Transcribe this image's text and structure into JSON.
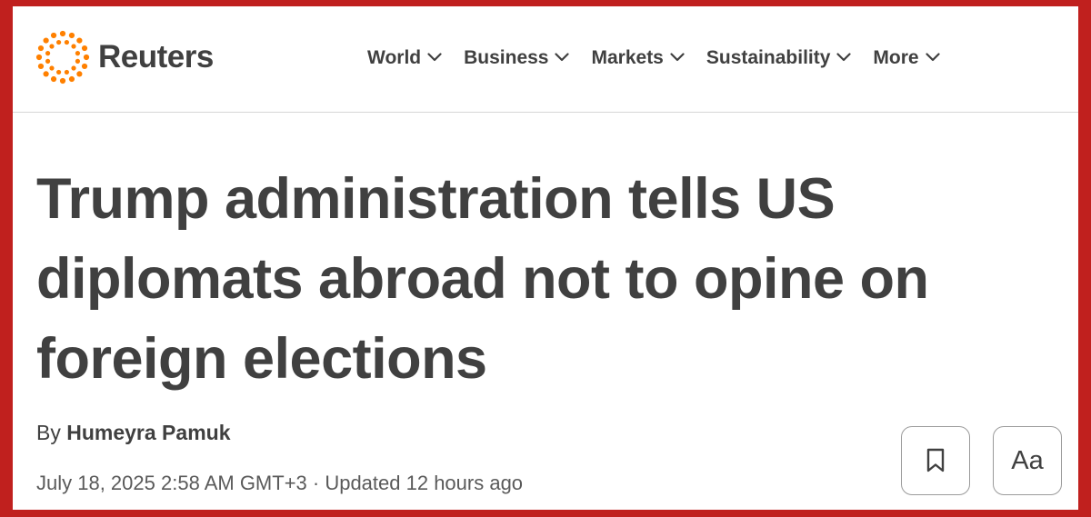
{
  "header": {
    "brand": "Reuters",
    "brand_color": "#ff8000",
    "nav": [
      {
        "label": "World"
      },
      {
        "label": "Business"
      },
      {
        "label": "Markets"
      },
      {
        "label": "Sustainability"
      },
      {
        "label": "More"
      }
    ]
  },
  "article": {
    "headline": "Trump administration tells US diplomats abroad not to opine on foreign elections",
    "byline_prefix": "By",
    "author": "Humeyra Pamuk",
    "dateline": "July 18, 2025 2:58 AM GMT+3 · Updated 12 hours ago"
  },
  "actions": {
    "bookmark_icon": "bookmark-icon",
    "text_size_label": "Aa"
  },
  "colors": {
    "frame": "#c0201e",
    "text": "#404040"
  }
}
